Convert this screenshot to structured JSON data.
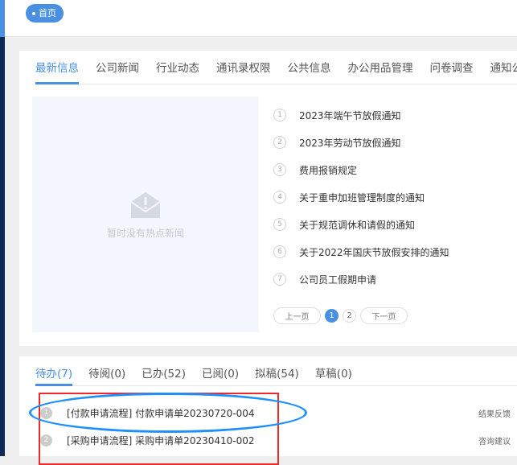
{
  "breadcrumb": {
    "home": "首页"
  },
  "news_tabs": [
    "最新信息",
    "公司新闻",
    "行业动态",
    "通讯录权限",
    "公共信息",
    "办公用品管理",
    "问卷调查",
    "通知公告"
  ],
  "empty_text": "暂时没有热点新闻",
  "news": [
    "2023年端午节放假通知",
    "2023年劳动节放假通知",
    "费用报销规定",
    "关于重申加班管理制度的通知",
    "关于规范调休和请假的通知",
    "关于2022年国庆节放假安排的通知",
    "公司员工假期申请"
  ],
  "pager": {
    "prev": "上一页",
    "pages": [
      "1",
      "2"
    ],
    "current": "1",
    "next": "下一页"
  },
  "task_tabs": [
    "待办(7)",
    "待阅(0)",
    "已办(52)",
    "已阅(0)",
    "拟稿(54)",
    "草稿(0)"
  ],
  "tasks": [
    {
      "num": "1",
      "title": "[付款申请流程] 付款申请单20230720-004",
      "action": "结果反馈"
    },
    {
      "num": "2",
      "title": "[采购申请流程] 采购申请单20230410-002",
      "action": "咨询建议"
    }
  ],
  "colors": {
    "accent": "#4a90e2",
    "annotation_red": "#f02828",
    "annotation_blue": "#1e90ff"
  }
}
